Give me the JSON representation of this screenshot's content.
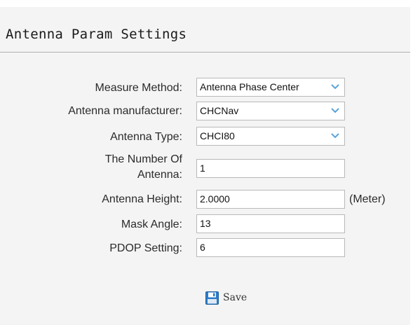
{
  "page": {
    "title": "Antenna Param Settings"
  },
  "form": {
    "measure_method": {
      "label": "Measure Method:",
      "value": "Antenna Phase Center"
    },
    "antenna_manufacturer": {
      "label": "Antenna manufacturer:",
      "value": "CHCNav"
    },
    "antenna_type": {
      "label": "Antenna Type:",
      "value": "CHCI80"
    },
    "number_of_antenna": {
      "label": "The Number Of Antenna:",
      "value": "1"
    },
    "antenna_height": {
      "label": "Antenna Height:",
      "value": "2.0000",
      "unit": "(Meter)"
    },
    "mask_angle": {
      "label": "Mask Angle:",
      "value": "13"
    },
    "pdop_setting": {
      "label": "PDOP Setting:",
      "value": "6"
    }
  },
  "actions": {
    "save_label": "Save",
    "save_icon": "floppy-disk-icon"
  },
  "colors": {
    "panel_background": "#f4f4f4",
    "chevron": "#5ba3d9",
    "save_icon": "#2d7cc8"
  }
}
